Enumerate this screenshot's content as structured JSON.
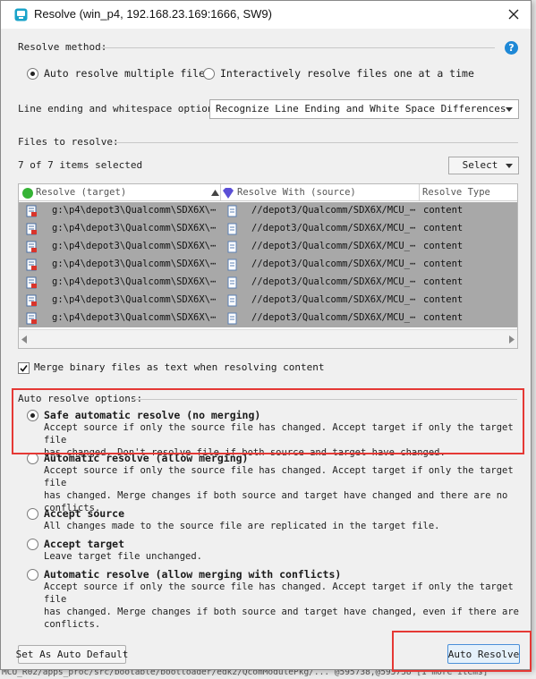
{
  "window": {
    "title": "Resolve (win_p4,  192.168.23.169:1666,  SW9)"
  },
  "resolve_method": {
    "label": "Resolve method:",
    "options": [
      {
        "label": "Auto resolve multiple files",
        "selected": true
      },
      {
        "label": "Interactively resolve files one at a time",
        "selected": false
      }
    ]
  },
  "line_ending": {
    "label": "Line ending and whitespace options",
    "value": "Recognize Line Ending and White Space Differences"
  },
  "files": {
    "label": "Files to resolve:",
    "count_text": "7 of 7 items selected",
    "select_button": "Select",
    "columns": [
      "Resolve (target)",
      "Resolve With (source)",
      "Resolve Type"
    ],
    "rows": [
      {
        "target": "g:\\p4\\depot3\\Qualcomm\\SDX6X\\⋯",
        "source": "//depot3/Qualcomm/SDX6X/MCU_⋯",
        "type": "content"
      },
      {
        "target": "g:\\p4\\depot3\\Qualcomm\\SDX6X\\⋯",
        "source": "//depot3/Qualcomm/SDX6X/MCU_⋯",
        "type": "content"
      },
      {
        "target": "g:\\p4\\depot3\\Qualcomm\\SDX6X\\⋯",
        "source": "//depot3/Qualcomm/SDX6X/MCU_⋯",
        "type": "content"
      },
      {
        "target": "g:\\p4\\depot3\\Qualcomm\\SDX6X\\⋯",
        "source": "//depot3/Qualcomm/SDX6X/MCU_⋯",
        "type": "content"
      },
      {
        "target": "g:\\p4\\depot3\\Qualcomm\\SDX6X\\⋯",
        "source": "//depot3/Qualcomm/SDX6X/MCU_⋯",
        "type": "content"
      },
      {
        "target": "g:\\p4\\depot3\\Qualcomm\\SDX6X\\⋯",
        "source": "//depot3/Qualcomm/SDX6X/MCU_⋯",
        "type": "content"
      },
      {
        "target": "g:\\p4\\depot3\\Qualcomm\\SDX6X\\⋯",
        "source": "//depot3/Qualcomm/SDX6X/MCU_⋯",
        "type": "content"
      }
    ]
  },
  "merge_binary": {
    "label": "Merge binary files as text when resolving content",
    "checked": true
  },
  "auto_options": {
    "label": "Auto resolve options:",
    "items": [
      {
        "title": "Safe automatic resolve (no merging)",
        "selected": true,
        "desc1": "Accept source if only the source file has changed. Accept target if only the target file",
        "desc2": "has changed. Don't resolve file if both source and target have changed.",
        "desc3": ""
      },
      {
        "title": "Automatic resolve (allow merging)",
        "selected": false,
        "desc1": "Accept source if only the source file has changed. Accept target if only the target file",
        "desc2": "has changed. Merge changes if both source and target have changed and there are no",
        "desc3": "conflicts."
      },
      {
        "title": "Accept source",
        "selected": false,
        "desc1": "All changes made to the source file are replicated in the target file.",
        "desc2": "",
        "desc3": ""
      },
      {
        "title": "Accept target",
        "selected": false,
        "desc1": "Leave target file unchanged.",
        "desc2": "",
        "desc3": ""
      },
      {
        "title": "Automatic resolve (allow merging with conflicts)",
        "selected": false,
        "desc1": "Accept source if only the source file has changed. Accept target if only the target file",
        "desc2": "has changed. Merge changes if both source and target have changed, even if there are",
        "desc3": "conflicts."
      }
    ]
  },
  "buttons": {
    "set_default": "Set As Auto Default",
    "auto_resolve": "Auto Resolve"
  },
  "background": {
    "status_path": "MCU_R02/apps_proc/src/bootable/bootloader/edk2/QcomModulePkg/... @595738,@595738 [1 more items]"
  },
  "colors": {
    "highlight": "#e53935",
    "selected_rows": "#a8a8a8",
    "help_icon": "#1e88d6"
  }
}
